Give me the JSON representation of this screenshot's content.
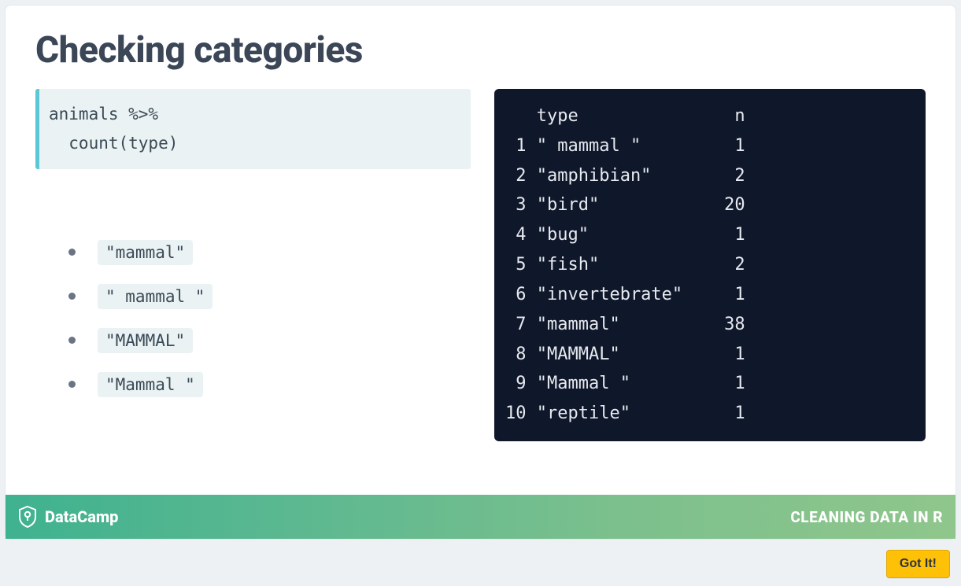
{
  "title": "Checking categories",
  "code_block": "animals %>%\n  count(type)",
  "bullets": [
    "\"mammal\"",
    "\" mammal \"",
    "\"MAMMAL\"",
    "\"Mammal \""
  ],
  "output_header_type": "type",
  "output_header_n": "n",
  "output_rows": [
    {
      "i": "1",
      "type": "\" mammal \"",
      "n": "1"
    },
    {
      "i": "2",
      "type": "\"amphibian\"",
      "n": "2"
    },
    {
      "i": "3",
      "type": "\"bird\"",
      "n": "20"
    },
    {
      "i": "4",
      "type": "\"bug\"",
      "n": "1"
    },
    {
      "i": "5",
      "type": "\"fish\"",
      "n": "2"
    },
    {
      "i": "6",
      "type": "\"invertebrate\"",
      "n": "1"
    },
    {
      "i": "7",
      "type": "\"mammal\"",
      "n": "38"
    },
    {
      "i": "8",
      "type": "\"MAMMAL\"",
      "n": "1"
    },
    {
      "i": "9",
      "type": "\"Mammal \"",
      "n": "1"
    },
    {
      "i": "10",
      "type": "\"reptile\"",
      "n": "1"
    }
  ],
  "footer": {
    "brand": "DataCamp",
    "course": "CLEANING DATA IN R"
  },
  "got_it_label": "Got It!"
}
